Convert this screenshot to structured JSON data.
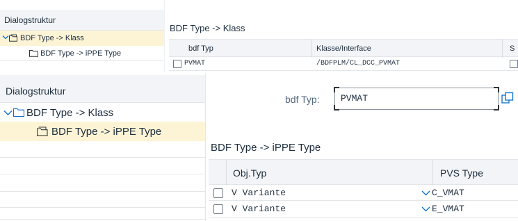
{
  "top_left_tree": {
    "header": "Dialogstruktur",
    "items": [
      {
        "label": "BDF Type -> Klass",
        "selected": true
      },
      {
        "label": "BDF Type -> iPPE Type",
        "selected": false
      }
    ]
  },
  "top_right": {
    "title": "BDF Type -> Klass",
    "columns": [
      "bdf Typ",
      "Klasse/Interface",
      "S"
    ],
    "rows": [
      {
        "bdf_typ": "PVMAT",
        "klasse": "/BDFPLM/CL_DCC_PVMAT"
      }
    ]
  },
  "bottom_left_tree": {
    "header": "Dialogstruktur",
    "items": [
      {
        "label": "BDF Type -> Klass",
        "selected": false
      },
      {
        "label": "BDF Type -> iPPE Type",
        "selected": true
      }
    ]
  },
  "bottom_right": {
    "field_label": "bdf Typ:",
    "field_value": "PVMAT",
    "title": "BDF Type -> iPPE Type",
    "columns": [
      "Obj.Typ",
      "PVS Type"
    ],
    "rows": [
      {
        "obj_typ": "V Variante",
        "pvs_type": "C_VMAT"
      },
      {
        "obj_typ": "V Variante",
        "pvs_type": "E_VMAT"
      }
    ]
  },
  "colors": {
    "selected_row": "#fdf4d6",
    "header_bg": "#f2f4f7",
    "accent": "#0a6ed1"
  }
}
